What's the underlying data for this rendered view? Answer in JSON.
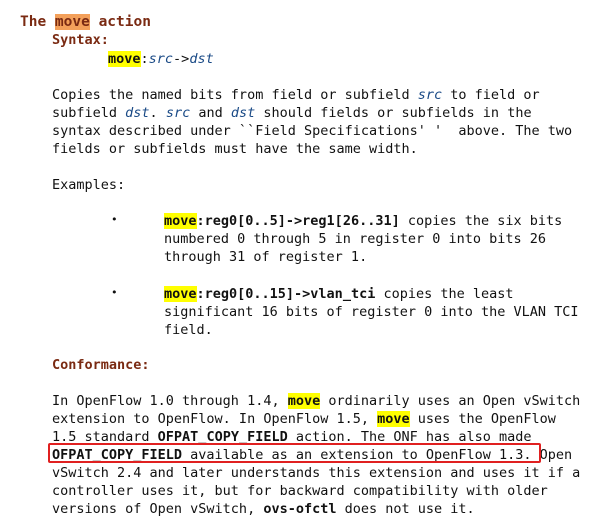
{
  "heading": {
    "pre": "The ",
    "word": "move",
    "post": " action"
  },
  "syntax": {
    "label": "Syntax:",
    "cmd": "move",
    "colon": ":",
    "src": "src",
    "arrow": "->",
    "dst": "dst"
  },
  "desc": {
    "l1a": "Copies the named bits from field or subfield ",
    "l1src": "src",
    "l1b": " to field or",
    "l2a": "subfield ",
    "l2dst": "dst",
    "l2b": ". ",
    "l2src": "src",
    "l2c": " and ",
    "l2dst2": "dst",
    "l2d": " should fields or subfields in the",
    "l3": "syntax described under ``Field Specifications' '  above. The two",
    "l4": "fields or subfields must have the same width."
  },
  "examples": {
    "label": "Examples:",
    "bullet": "•",
    "ex1": {
      "cmd": "move",
      "code": ":reg0[0..5]->reg1[26..31]",
      "t1": " copies the six bits",
      "t2": "numbered 0 through 5 in register 0 into bits 26",
      "t3": "through 31 of register 1."
    },
    "ex2": {
      "cmd": "move",
      "code": ":reg0[0..15]->vlan_tci",
      "t1": " copies the least",
      "t2": "significant 16 bits of register 0 into the VLAN TCI",
      "t3": "field."
    }
  },
  "conformance": {
    "label": "Conformance:",
    "l1a": "In OpenFlow 1.0 through 1.4, ",
    "l1move": "move",
    "l1b": " ordinarily uses an Open vSwitch",
    "l2a": "extension to OpenFlow. In OpenFlow 1.5, ",
    "l2move": "move",
    "l2b": " uses the OpenFlow",
    "l3a": "1.5 standard ",
    "l3code": "OFPAT_COPY_FIELD",
    "l3b": " action. The ONF has also made",
    "l4code": "OFPAT_COPY_FIELD",
    "l4b": " available as an extension to OpenFlow 1.3.",
    "l4c": " Open",
    "l5": "vSwitch 2.4 and later understands this extension and uses it if a",
    "l6": "controller uses it, but for backward compatibility with older",
    "l7a": "versions of Open vSwitch, ",
    "l7code": "ovs-ofctl",
    "l7b": " does not use it."
  },
  "colors": {
    "heading": "#7a2a12",
    "highlight": "#ffff00",
    "heading_highlight": "#f3a05a",
    "italic": "#1a4a86",
    "box": "#e02020"
  }
}
